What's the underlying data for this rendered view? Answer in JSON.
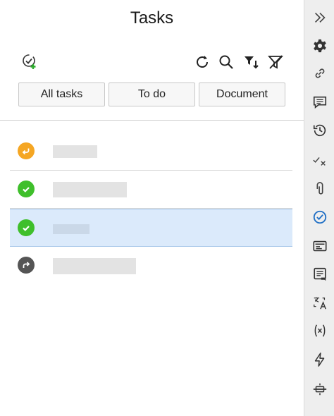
{
  "panel": {
    "title": "Tasks",
    "filters": [
      {
        "label": "All tasks"
      },
      {
        "label": "To do"
      },
      {
        "label": "Document"
      }
    ]
  },
  "tasks": [
    {
      "status": "returned",
      "status_color": "#f5a623",
      "selected": false,
      "label_redacted": true
    },
    {
      "status": "completed",
      "status_color": "#3fbf2b",
      "selected": false,
      "label_redacted": true
    },
    {
      "status": "completed",
      "status_color": "#3fbf2b",
      "selected": true,
      "label_redacted": true
    },
    {
      "status": "forwarded",
      "status_color": "#555555",
      "selected": false,
      "label_redacted": true
    }
  ],
  "toolbar_icons": [
    "add-task-icon",
    "refresh-icon",
    "search-icon",
    "filter-sort-icon",
    "clear-filter-icon"
  ],
  "rail_icons": [
    "collapse-icon",
    "gear-icon",
    "link-icon",
    "comment-icon",
    "history-icon",
    "approval-icon",
    "attachment-icon",
    "tasks-icon",
    "fields-icon",
    "notes-icon",
    "translate-icon",
    "variables-icon",
    "actions-icon",
    "workflow-icon"
  ],
  "colors": {
    "accent": "#1f6fc5",
    "selected_row": "#dbeafb",
    "rail_bg": "#eeeeee"
  }
}
